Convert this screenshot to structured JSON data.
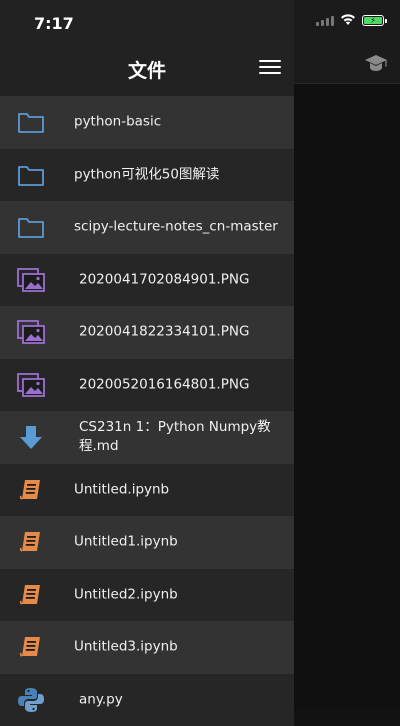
{
  "status_bar": {
    "time": "7:17"
  },
  "drawer": {
    "title": "文件",
    "files": [
      {
        "name": "python-basic",
        "type": "folder"
      },
      {
        "name": "python可视化50图解读",
        "type": "folder"
      },
      {
        "name": "scipy-lecture-notes_cn-master",
        "type": "folder"
      },
      {
        "name": "2020041702084901.PNG",
        "type": "image"
      },
      {
        "name": "2020041822334101.PNG",
        "type": "image"
      },
      {
        "name": "2020052016164801.PNG",
        "type": "image"
      },
      {
        "name": "CS231n 1：Python Numpy教程.md",
        "type": "markdown"
      },
      {
        "name": "Untitled.ipynb",
        "type": "notebook"
      },
      {
        "name": "Untitled1.ipynb",
        "type": "notebook"
      },
      {
        "name": "Untitled2.ipynb",
        "type": "notebook"
      },
      {
        "name": "Untitled3.ipynb",
        "type": "notebook"
      },
      {
        "name": "any.py",
        "type": "python"
      }
    ]
  },
  "colors": {
    "folder": "#5b9bd5",
    "image": "#9b6fd0",
    "markdown": "#5b9bd5",
    "notebook": "#e58a48",
    "python": "#4a82b8"
  }
}
